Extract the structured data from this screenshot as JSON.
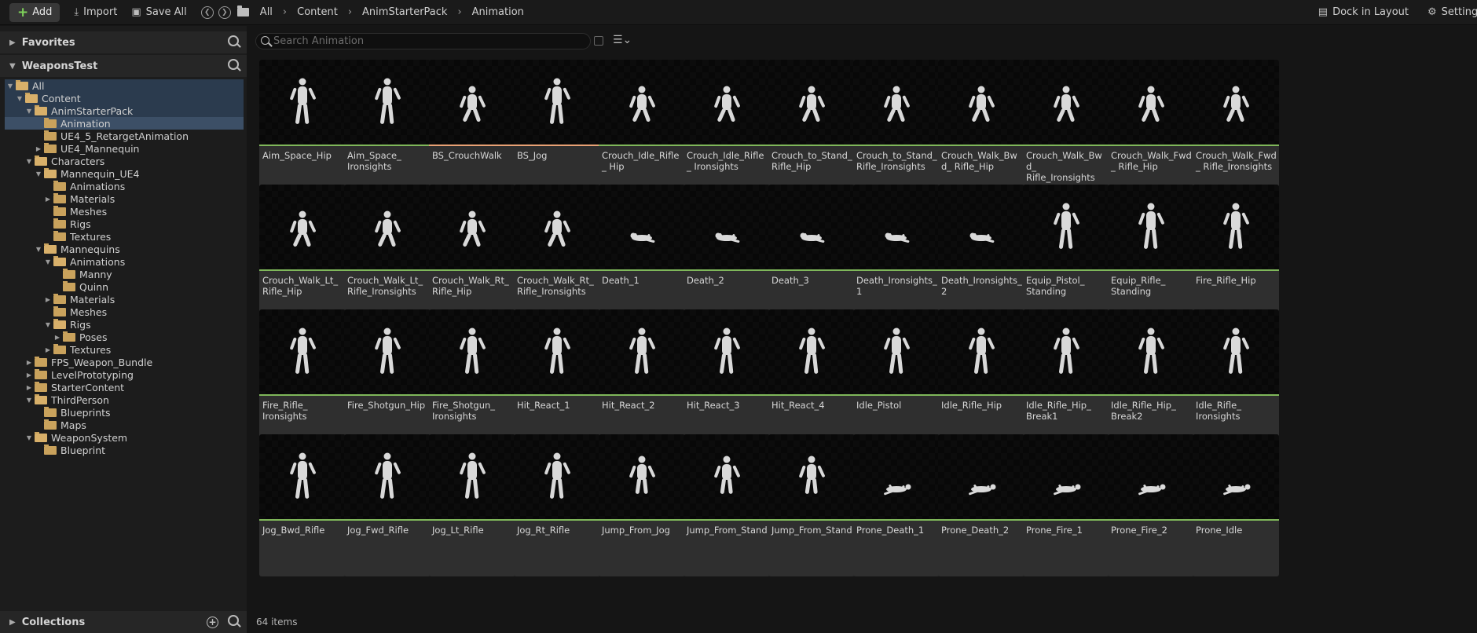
{
  "toolbar": {
    "add": "Add",
    "import": "Import",
    "save_all": "Save All",
    "breadcrumb": [
      "All",
      "Content",
      "AnimStarterPack",
      "Animation"
    ],
    "dock": "Dock in Layout",
    "settings": "Settings"
  },
  "left": {
    "favorites": "Favorites",
    "project": "WeaponsTest",
    "collections": "Collections",
    "tree": [
      {
        "label": "All",
        "depth": 0,
        "arrow": "down",
        "open": true
      },
      {
        "label": "Content",
        "depth": 1,
        "arrow": "down",
        "open": true
      },
      {
        "label": "AnimStarterPack",
        "depth": 2,
        "arrow": "down",
        "open": true
      },
      {
        "label": "Animation",
        "depth": 3,
        "arrow": "",
        "open": false,
        "selected": true
      },
      {
        "label": "UE4_5_RetargetAnimation",
        "depth": 3,
        "arrow": "",
        "open": false
      },
      {
        "label": "UE4_Mannequin",
        "depth": 3,
        "arrow": "right",
        "open": false
      },
      {
        "label": "Characters",
        "depth": 2,
        "arrow": "down",
        "open": true
      },
      {
        "label": "Mannequin_UE4",
        "depth": 3,
        "arrow": "down",
        "open": true
      },
      {
        "label": "Animations",
        "depth": 4,
        "arrow": "",
        "open": false
      },
      {
        "label": "Materials",
        "depth": 4,
        "arrow": "right",
        "open": false
      },
      {
        "label": "Meshes",
        "depth": 4,
        "arrow": "",
        "open": false
      },
      {
        "label": "Rigs",
        "depth": 4,
        "arrow": "",
        "open": false
      },
      {
        "label": "Textures",
        "depth": 4,
        "arrow": "",
        "open": false
      },
      {
        "label": "Mannequins",
        "depth": 3,
        "arrow": "down",
        "open": true
      },
      {
        "label": "Animations",
        "depth": 4,
        "arrow": "down",
        "open": true
      },
      {
        "label": "Manny",
        "depth": 5,
        "arrow": "",
        "open": false
      },
      {
        "label": "Quinn",
        "depth": 5,
        "arrow": "",
        "open": false
      },
      {
        "label": "Materials",
        "depth": 4,
        "arrow": "right",
        "open": false
      },
      {
        "label": "Meshes",
        "depth": 4,
        "arrow": "",
        "open": false
      },
      {
        "label": "Rigs",
        "depth": 4,
        "arrow": "down",
        "open": true
      },
      {
        "label": "Poses",
        "depth": 5,
        "arrow": "right",
        "open": false
      },
      {
        "label": "Textures",
        "depth": 4,
        "arrow": "right",
        "open": false
      },
      {
        "label": "FPS_Weapon_Bundle",
        "depth": 2,
        "arrow": "right",
        "open": false
      },
      {
        "label": "LevelPrototyping",
        "depth": 2,
        "arrow": "right",
        "open": false
      },
      {
        "label": "StarterContent",
        "depth": 2,
        "arrow": "right",
        "open": false
      },
      {
        "label": "ThirdPerson",
        "depth": 2,
        "arrow": "down",
        "open": true
      },
      {
        "label": "Blueprints",
        "depth": 3,
        "arrow": "",
        "open": false
      },
      {
        "label": "Maps",
        "depth": 3,
        "arrow": "",
        "open": false
      },
      {
        "label": "WeaponSystem",
        "depth": 2,
        "arrow": "down",
        "open": true
      },
      {
        "label": "Blueprint",
        "depth": 3,
        "arrow": "",
        "open": false
      }
    ]
  },
  "content": {
    "search_placeholder": "Search Animation",
    "item_count": "64 items",
    "assets": [
      {
        "name": "Aim_Space_Hip",
        "type": "Animation Sequence",
        "kind": "anim",
        "pose": "stand"
      },
      {
        "name": "Aim_Space_ Ironsights",
        "type": "Animation Sequence",
        "kind": "anim",
        "pose": "stand"
      },
      {
        "name": "BS_CrouchWalk",
        "type": "Blend Space",
        "kind": "blend",
        "pose": "crouch"
      },
      {
        "name": "BS_Jog",
        "type": "Blend Space",
        "kind": "blend",
        "pose": "stand"
      },
      {
        "name": "Crouch_Idle_Rifle_ Hip",
        "type": "Animation Sequence",
        "kind": "anim",
        "pose": "crouch"
      },
      {
        "name": "Crouch_Idle_Rifle_ Ironsights",
        "type": "Animation Sequence",
        "kind": "anim",
        "pose": "crouch"
      },
      {
        "name": "Crouch_to_Stand_ Rifle_Hip",
        "type": "Animation Sequence",
        "kind": "anim",
        "pose": "crouch"
      },
      {
        "name": "Crouch_to_Stand_ Rifle_Ironsights",
        "type": "Animation Sequence",
        "kind": "anim",
        "pose": "crouch"
      },
      {
        "name": "Crouch_Walk_Bwd_ Rifle_Hip",
        "type": "Animation Sequence",
        "kind": "anim",
        "pose": "crouch"
      },
      {
        "name": "Crouch_Walk_Bwd_ Rifle_Ironsights",
        "type": "Animation Sequence",
        "kind": "anim",
        "pose": "crouch"
      },
      {
        "name": "Crouch_Walk_Fwd_ Rifle_Hip",
        "type": "Animation Sequence",
        "kind": "anim",
        "pose": "crouch"
      },
      {
        "name": "Crouch_Walk_Fwd_ Rifle_Ironsights",
        "type": "Animation Sequence",
        "kind": "anim",
        "pose": "crouch"
      },
      {
        "name": "Crouch_Walk_Lt_ Rifle_Hip",
        "type": "Animation Sequence",
        "kind": "anim",
        "pose": "crouch"
      },
      {
        "name": "Crouch_Walk_Lt_ Rifle_Ironsights",
        "type": "Animation Sequence",
        "kind": "anim",
        "pose": "crouch"
      },
      {
        "name": "Crouch_Walk_Rt_ Rifle_Hip",
        "type": "Animation Sequence",
        "kind": "anim",
        "pose": "crouch"
      },
      {
        "name": "Crouch_Walk_Rt_ Rifle_Ironsights",
        "type": "Animation Sequence",
        "kind": "anim",
        "pose": "crouch"
      },
      {
        "name": "Death_1",
        "type": "Animation Sequence",
        "kind": "anim",
        "pose": "lying"
      },
      {
        "name": "Death_2",
        "type": "Animation Sequence",
        "kind": "anim",
        "pose": "lying"
      },
      {
        "name": "Death_3",
        "type": "Animation Sequence",
        "kind": "anim",
        "pose": "lying"
      },
      {
        "name": "Death_Ironsights_1",
        "type": "Animation Sequence",
        "kind": "anim",
        "pose": "lying"
      },
      {
        "name": "Death_Ironsights_2",
        "type": "Animation Sequence",
        "kind": "anim",
        "pose": "lying"
      },
      {
        "name": "Equip_Pistol_ Standing",
        "type": "Animation Sequence",
        "kind": "anim",
        "pose": "stand"
      },
      {
        "name": "Equip_Rifle_ Standing",
        "type": "Animation Sequence",
        "kind": "anim",
        "pose": "stand"
      },
      {
        "name": "Fire_Rifle_Hip",
        "type": "Animation Sequence",
        "kind": "anim",
        "pose": "stand"
      },
      {
        "name": "Fire_Rifle_ Ironsights",
        "type": "Animation Sequence",
        "kind": "anim",
        "pose": "stand"
      },
      {
        "name": "Fire_Shotgun_Hip",
        "type": "Animation Sequence",
        "kind": "anim",
        "pose": "stand"
      },
      {
        "name": "Fire_Shotgun_ Ironsights",
        "type": "Animation Sequence",
        "kind": "anim",
        "pose": "stand"
      },
      {
        "name": "Hit_React_1",
        "type": "Animation Sequence",
        "kind": "anim",
        "pose": "stand"
      },
      {
        "name": "Hit_React_2",
        "type": "Animation Sequence",
        "kind": "anim",
        "pose": "stand"
      },
      {
        "name": "Hit_React_3",
        "type": "Animation Sequence",
        "kind": "anim",
        "pose": "stand"
      },
      {
        "name": "Hit_React_4",
        "type": "Animation Sequence",
        "kind": "anim",
        "pose": "stand"
      },
      {
        "name": "Idle_Pistol",
        "type": "Animation Sequence",
        "kind": "anim",
        "pose": "stand"
      },
      {
        "name": "Idle_Rifle_Hip",
        "type": "Animation Sequence",
        "kind": "anim",
        "pose": "stand"
      },
      {
        "name": "Idle_Rifle_Hip_ Break1",
        "type": "Animation Sequence",
        "kind": "anim",
        "pose": "stand"
      },
      {
        "name": "Idle_Rifle_Hip_ Break2",
        "type": "Animation Sequence",
        "kind": "anim",
        "pose": "stand"
      },
      {
        "name": "Idle_Rifle_ Ironsights",
        "type": "Animation Sequence",
        "kind": "anim",
        "pose": "stand"
      },
      {
        "name": "Jog_Bwd_Rifle",
        "type": "",
        "kind": "anim",
        "pose": "stand"
      },
      {
        "name": "Jog_Fwd_Rifle",
        "type": "",
        "kind": "anim",
        "pose": "stand"
      },
      {
        "name": "Jog_Lt_Rifle",
        "type": "",
        "kind": "anim",
        "pose": "stand"
      },
      {
        "name": "Jog_Rt_Rifle",
        "type": "",
        "kind": "anim",
        "pose": "stand"
      },
      {
        "name": "Jump_From_Jog",
        "type": "",
        "kind": "anim",
        "pose": "jump"
      },
      {
        "name": "Jump_From_Stand",
        "type": "",
        "kind": "anim",
        "pose": "jump"
      },
      {
        "name": "Jump_From_Stand",
        "type": "",
        "kind": "anim",
        "pose": "jump"
      },
      {
        "name": "Prone_Death_1",
        "type": "",
        "kind": "anim",
        "pose": "prone"
      },
      {
        "name": "Prone_Death_2",
        "type": "",
        "kind": "anim",
        "pose": "prone"
      },
      {
        "name": "Prone_Fire_1",
        "type": "",
        "kind": "anim",
        "pose": "prone"
      },
      {
        "name": "Prone_Fire_2",
        "type": "",
        "kind": "anim",
        "pose": "prone"
      },
      {
        "name": "Prone_Idle",
        "type": "",
        "kind": "anim",
        "pose": "prone"
      }
    ]
  }
}
